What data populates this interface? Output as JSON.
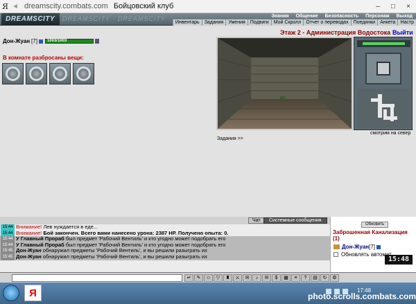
{
  "browser": {
    "url": "dreamscity.combats.com",
    "title": "Бойцовский клуб",
    "yandex_glyph": "Я",
    "back_glyph": "◄"
  },
  "header": {
    "logo": "DREAMSCITY",
    "watermark": "DREAMSCITY · DREAMSCITY",
    "menu_top": [
      "Знания",
      "Общение",
      "Безопасность",
      "Персонаж",
      "Выход"
    ],
    "menu_bottom": [
      "Инвентарь",
      "Задания",
      "Умения",
      "Подвиги",
      "Мой Скролл",
      "Отчет о переводах",
      "Поединки",
      "Анкета",
      "Настр"
    ]
  },
  "player": {
    "name": "Дон-Жуан",
    "level": "[7]",
    "hp_text": "1003/1003",
    "hp_fraction": 1.0
  },
  "location": {
    "title": "Этаж 2 - Администрация Водостока",
    "exit": "Выйти",
    "items_title": "В комнате разбросаны вещи:",
    "view_caption": "смотрим на север",
    "tasks": "Задания >>"
  },
  "chat": {
    "tab_chat": "Чат",
    "tab_system": "Системные сообщения",
    "lines": [
      {
        "time": "15:44",
        "pre": "Внимание!",
        "text": "Лев нуждается в еде...",
        "gray": false
      },
      {
        "time": "15:44",
        "pre": "Внимание!",
        "text": "Бой закончен. Всего вами нанесено урона: 2387 HP. Получено опыта: 0.",
        "gray": false
      },
      {
        "time": "15:44",
        "pre": "У Главный Прораб",
        "text": "был предмет 'Рабочий Вентиль' и кто угодно может подобрать его",
        "gray": true
      },
      {
        "time": "15:44",
        "pre": "У Главный Прораб",
        "text": "был предмет 'Рабочий Вентиль' и кто угодно может подобрать его",
        "gray": true
      },
      {
        "time": "15:45",
        "pre": "Дон-Жуан",
        "text": "обнаружил предметы 'Рабочий Вентиль', и вы решили разыграть их",
        "gray": true
      },
      {
        "time": "15:45",
        "pre": "Дон-Жуан",
        "text": "обнаружил предметы 'Рабочий Вентиль', и вы решили разыграть их",
        "gray": true
      }
    ]
  },
  "room": {
    "refresh": "Обновить",
    "name": "Заброшенная Канализация (1)",
    "user": "Дон-Жуан",
    "user_level": "[7]",
    "auto_refresh": "Обновлять автомат."
  },
  "clock": "15:48",
  "taskbar": {
    "app_glyph": "Я",
    "time": "17:48"
  },
  "footer_watermark": "photo.scrolls.combats.com",
  "icons": {
    "back": "back-arrow-icon",
    "item": "valve-item-icon",
    "user": "user-icon"
  }
}
